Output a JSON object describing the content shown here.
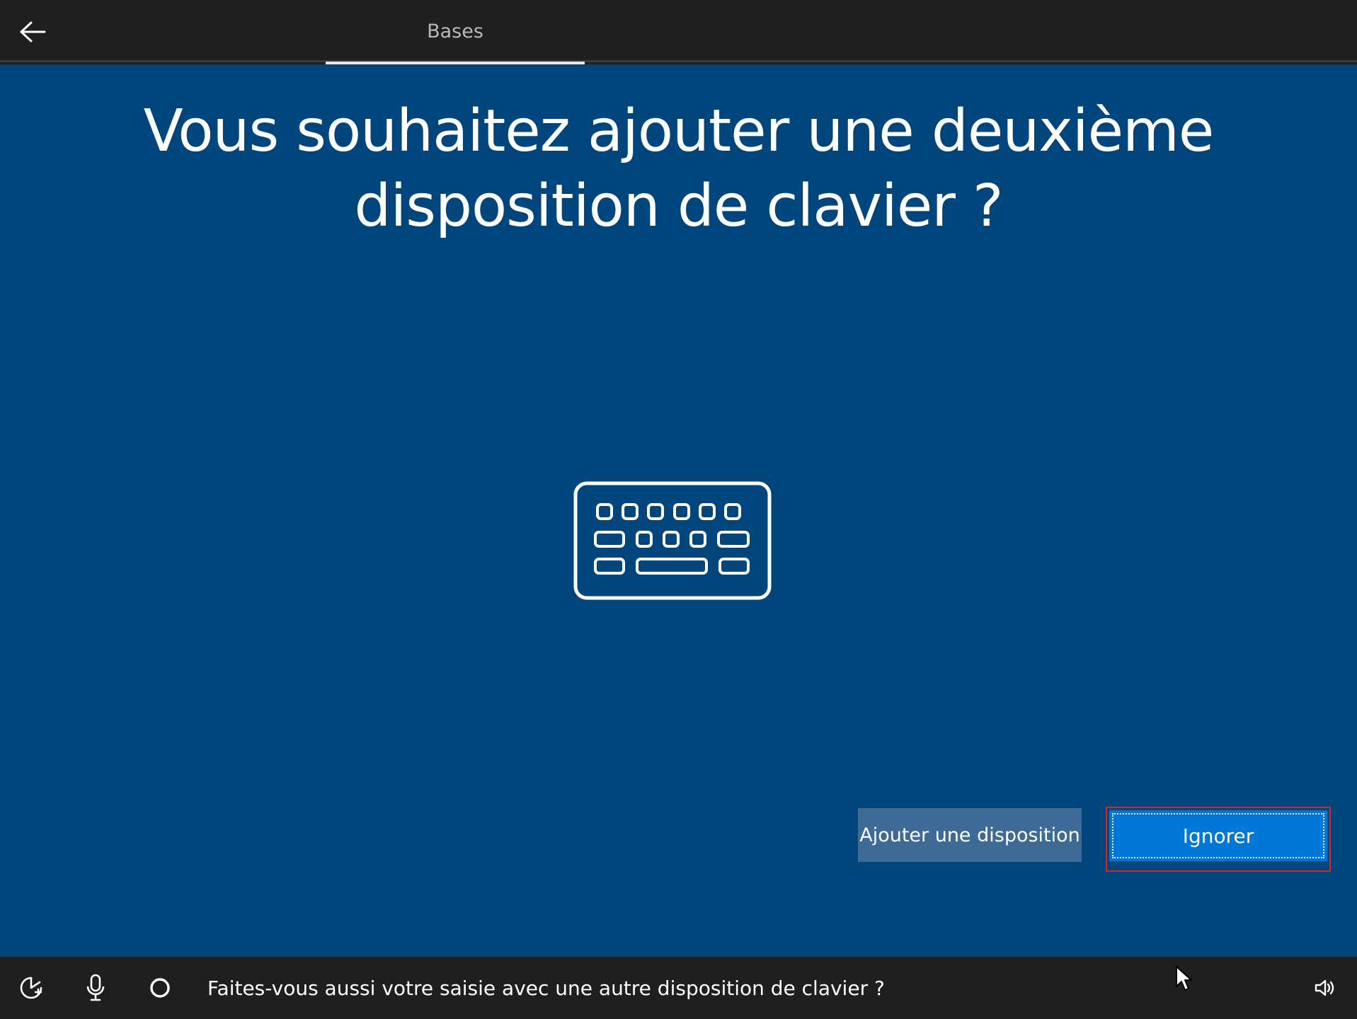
{
  "header": {
    "back_icon": "arrow-left-icon",
    "tab_label": "Bases"
  },
  "main": {
    "title": "Vous souhaitez ajouter une deuxième disposition de clavier ?",
    "illustration_icon": "keyboard-icon",
    "background_color": "#00457b"
  },
  "buttons": {
    "add_layout_label": "Ajouter une disposition",
    "skip_label": "Ignorer",
    "skip_color": "#0078d7",
    "add_layout_color": "#3d6b96"
  },
  "footer": {
    "icons": [
      "accessibility-icon",
      "microphone-icon",
      "cortana-circle-icon",
      "volume-icon"
    ],
    "narration_text": "Faites-vous aussi votre saisie avec une autre disposition de clavier ?"
  }
}
